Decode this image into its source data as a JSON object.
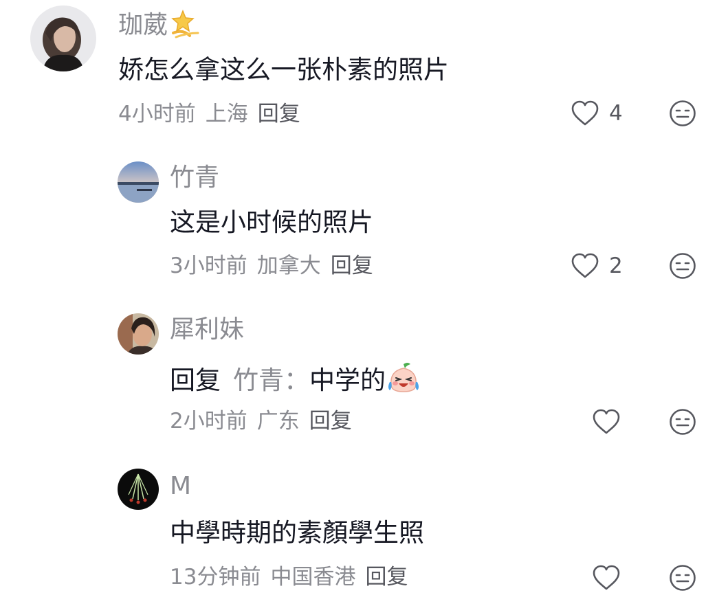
{
  "comments": [
    {
      "username": "珈葳",
      "username_emoji_icon": "dizzy-star-icon",
      "text": "娇怎么拿这么一张朴素的照片",
      "time": "4小时前",
      "location": "上海",
      "reply_label": "回复",
      "likes": "4"
    },
    {
      "username": "竹青",
      "text": "这是小时候的照片",
      "time": "3小时前",
      "location": "加拿大",
      "reply_label": "回复",
      "likes": "2"
    },
    {
      "username": "犀利妹",
      "reply_prefix": "回复",
      "reply_to": "竹青：",
      "text": "中学的",
      "text_emoji_icon": "crying-laughing-peach-icon",
      "time": "2小时前",
      "location": "广东",
      "reply_label": "回复",
      "likes": ""
    },
    {
      "username": "M",
      "text": "中學時期的素顏學生照",
      "time": "13分钟前",
      "location": "中国香港",
      "reply_label": "回复",
      "likes": ""
    }
  ],
  "icons": {
    "like": "heart-outline-icon",
    "dislike": "neutral-face-icon"
  },
  "colors": {
    "primary_text": "#161823",
    "secondary_text": "#8a8b91",
    "icon": "#56575e"
  }
}
